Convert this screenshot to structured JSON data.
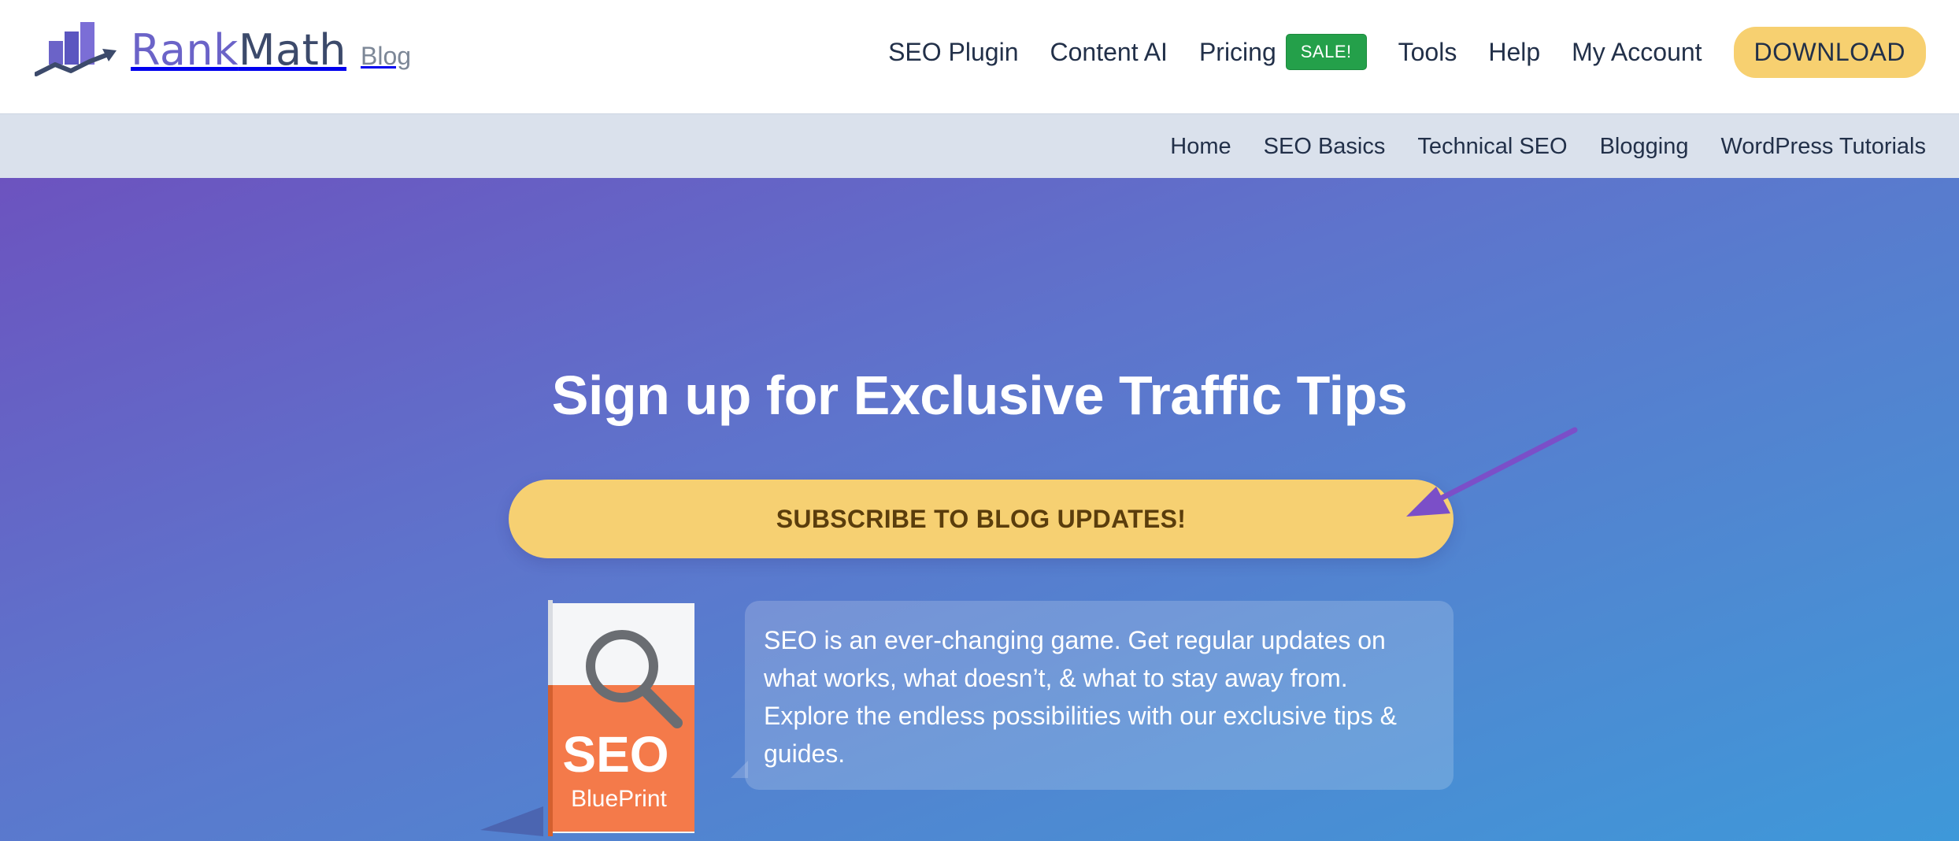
{
  "brand": {
    "name_part1": "Rank",
    "name_part2": "Math",
    "section": "Blog",
    "logo_icon": "rankmath-bars-chart-icon",
    "colors": {
      "rank": "#6b63c8",
      "math": "#3c4a6b"
    }
  },
  "main_nav": {
    "items": [
      {
        "label": "SEO Plugin"
      },
      {
        "label": "Content AI"
      },
      {
        "label": "Pricing",
        "badge": "SALE!"
      },
      {
        "label": "Tools"
      },
      {
        "label": "Help"
      },
      {
        "label": "My Account"
      }
    ],
    "download_label": "DOWNLOAD"
  },
  "sub_nav": {
    "items": [
      {
        "label": "Home"
      },
      {
        "label": "SEO Basics"
      },
      {
        "label": "Technical SEO"
      },
      {
        "label": "Blogging"
      },
      {
        "label": "WordPress Tutorials"
      }
    ]
  },
  "hero": {
    "title": "Sign up for Exclusive Traffic Tips",
    "button_label": "SUBSCRIBE TO BLOG UPDATES!",
    "book": {
      "title": "SEO",
      "subtitle": "BluePrint",
      "icon": "magnifier-icon"
    },
    "description": "SEO is an ever-changing game. Get regular updates on what works, what doesn’t, & what to stay away from. Explore the endless possibilities with our exclusive tips & guides.",
    "colors": {
      "button": "#f6d072",
      "button_text": "#5a3d0c",
      "arrow": "#7b4fc8",
      "book_orange": "#f47a4a"
    }
  }
}
